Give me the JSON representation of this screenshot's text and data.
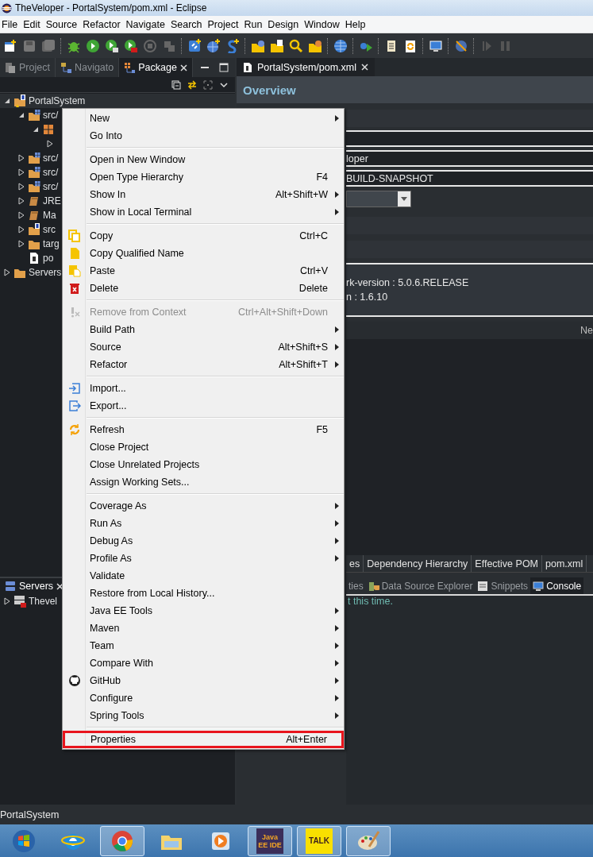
{
  "window": {
    "title": "TheVeloper - PortalSystem/pom.xml - Eclipse"
  },
  "menu_bar": [
    "File",
    "Edit",
    "Source",
    "Refactor",
    "Navigate",
    "Search",
    "Project",
    "Run",
    "Design",
    "Window",
    "Help"
  ],
  "view_tabs": [
    {
      "label": "Project",
      "selected": false
    },
    {
      "label": "Navigato",
      "selected": false
    },
    {
      "label": "Package",
      "selected": true
    }
  ],
  "project_tree": [
    {
      "label": "PortalSystem",
      "kind": "project",
      "expanded": true,
      "children": [
        {
          "label": "src/",
          "kind": "source-folder",
          "expanded": true,
          "children": [
            {
              "kind": "package",
              "expanded": true,
              "children": [
                {
                  "expanded": false
                }
              ]
            }
          ]
        },
        {
          "label": "src/",
          "kind": "source-folder",
          "expanded": false
        },
        {
          "label": "src/",
          "kind": "source-folder",
          "expanded": false
        },
        {
          "label": "src/",
          "kind": "source-folder",
          "expanded": false
        },
        {
          "label": "JRE",
          "kind": "library",
          "expanded": false
        },
        {
          "label": "Ma",
          "kind": "library",
          "expanded": false
        },
        {
          "label": "src",
          "kind": "spring-folder",
          "expanded": false
        },
        {
          "label": "targ",
          "kind": "folder",
          "expanded": false
        },
        {
          "label": "po",
          "kind": "file"
        }
      ]
    },
    {
      "label": "Servers",
      "kind": "folder",
      "expanded": false
    }
  ],
  "servers_view": {
    "tab": {
      "label": "Servers",
      "selected": true
    },
    "rows": [
      {
        "label": "Thevel",
        "expanded": false
      }
    ]
  },
  "editor": {
    "tab": {
      "label": "PortalSystem/pom.xml",
      "selected": true
    },
    "heading": "Overview",
    "fields": [
      "loper",
      "BUILD-SNAPSHOT"
    ],
    "properties": [
      "rk-version : 5.0.6.RELEASE",
      "n : 1.6.10"
    ],
    "side_label": "Ne",
    "pom_tabs": [
      {
        "label": "es",
        "selected": false
      },
      {
        "label": "Dependency Hierarchy",
        "selected": false
      },
      {
        "label": "Effective POM",
        "selected": false
      },
      {
        "label": "pom.xml",
        "selected": false
      }
    ]
  },
  "console": {
    "tabs": [
      {
        "label": "ties",
        "selected": false
      },
      {
        "label": "Data Source Explorer",
        "selected": false
      },
      {
        "label": "Snippets",
        "selected": false
      },
      {
        "label": "Console",
        "selected": true
      }
    ],
    "message": "t this time."
  },
  "context_menu": [
    {
      "kind": "item",
      "label": "New",
      "submenu": true,
      "disabled": false,
      "outlined": false
    },
    {
      "kind": "item",
      "label": "Go Into",
      "submenu": false,
      "disabled": false,
      "outlined": false
    },
    {
      "kind": "separator"
    },
    {
      "kind": "item",
      "label": "Open in New Window",
      "submenu": false,
      "disabled": false,
      "outlined": false
    },
    {
      "kind": "item",
      "label": "Open Type Hierarchy",
      "shortcut": "F4",
      "submenu": false,
      "disabled": false,
      "outlined": false
    },
    {
      "kind": "item",
      "label": "Show In",
      "shortcut": "Alt+Shift+W",
      "submenu": true,
      "disabled": false,
      "outlined": false
    },
    {
      "kind": "item",
      "label": "Show in Local Terminal",
      "submenu": true,
      "disabled": false,
      "outlined": false
    },
    {
      "kind": "separator"
    },
    {
      "kind": "item",
      "label": "Copy",
      "shortcut": "Ctrl+C",
      "submenu": false,
      "disabled": false,
      "outlined": false
    },
    {
      "kind": "item",
      "label": "Copy Qualified Name",
      "submenu": false,
      "disabled": false,
      "outlined": false
    },
    {
      "kind": "item",
      "label": "Paste",
      "shortcut": "Ctrl+V",
      "submenu": false,
      "disabled": false,
      "outlined": false
    },
    {
      "kind": "item",
      "label": "Delete",
      "shortcut": "Delete",
      "submenu": false,
      "disabled": false,
      "outlined": false
    },
    {
      "kind": "separator"
    },
    {
      "kind": "item",
      "label": "Remove from Context",
      "shortcut": "Ctrl+Alt+Shift+Down",
      "submenu": false,
      "disabled": true,
      "outlined": false
    },
    {
      "kind": "item",
      "label": "Build Path",
      "submenu": true,
      "disabled": false,
      "outlined": false
    },
    {
      "kind": "item",
      "label": "Source",
      "shortcut": "Alt+Shift+S",
      "submenu": true,
      "disabled": false,
      "outlined": false
    },
    {
      "kind": "item",
      "label": "Refactor",
      "shortcut": "Alt+Shift+T",
      "submenu": true,
      "disabled": false,
      "outlined": false
    },
    {
      "kind": "separator"
    },
    {
      "kind": "item",
      "label": "Import...",
      "submenu": false,
      "disabled": false,
      "outlined": false
    },
    {
      "kind": "item",
      "label": "Export...",
      "submenu": false,
      "disabled": false,
      "outlined": false
    },
    {
      "kind": "separator"
    },
    {
      "kind": "item",
      "label": "Refresh",
      "shortcut": "F5",
      "submenu": false,
      "disabled": false,
      "outlined": false
    },
    {
      "kind": "item",
      "label": "Close Project",
      "submenu": false,
      "disabled": false,
      "outlined": false
    },
    {
      "kind": "item",
      "label": "Close Unrelated Projects",
      "submenu": false,
      "disabled": false,
      "outlined": false
    },
    {
      "kind": "item",
      "label": "Assign Working Sets...",
      "submenu": false,
      "disabled": false,
      "outlined": false
    },
    {
      "kind": "separator"
    },
    {
      "kind": "item",
      "label": "Coverage As",
      "submenu": true,
      "disabled": false,
      "outlined": false
    },
    {
      "kind": "item",
      "label": "Run As",
      "submenu": true,
      "disabled": false,
      "outlined": false
    },
    {
      "kind": "item",
      "label": "Debug As",
      "submenu": true,
      "disabled": false,
      "outlined": false
    },
    {
      "kind": "item",
      "label": "Profile As",
      "submenu": true,
      "disabled": false,
      "outlined": false
    },
    {
      "kind": "item",
      "label": "Validate",
      "submenu": false,
      "disabled": false,
      "outlined": false
    },
    {
      "kind": "item",
      "label": "Restore from Local History...",
      "submenu": false,
      "disabled": false,
      "outlined": false
    },
    {
      "kind": "item",
      "label": "Java EE Tools",
      "submenu": true,
      "disabled": false,
      "outlined": false
    },
    {
      "kind": "item",
      "label": "Maven",
      "submenu": true,
      "disabled": false,
      "outlined": false
    },
    {
      "kind": "item",
      "label": "Team",
      "submenu": true,
      "disabled": false,
      "outlined": false
    },
    {
      "kind": "item",
      "label": "Compare With",
      "submenu": true,
      "disabled": false,
      "outlined": false
    },
    {
      "kind": "item",
      "label": "GitHub",
      "submenu": true,
      "disabled": false,
      "outlined": false
    },
    {
      "kind": "item",
      "label": "Configure",
      "submenu": true,
      "disabled": false,
      "outlined": false
    },
    {
      "kind": "item",
      "label": "Spring Tools",
      "submenu": true,
      "disabled": false,
      "outlined": false
    },
    {
      "kind": "separator"
    },
    {
      "kind": "item",
      "label": "Properties",
      "shortcut": "Alt+Enter",
      "submenu": false,
      "disabled": false,
      "outlined": true
    }
  ],
  "status_bar": "PortalSystem",
  "taskbar": [
    {
      "kind": "start",
      "running": false
    },
    {
      "kind": "ie",
      "running": false
    },
    {
      "kind": "chrome",
      "running": true
    },
    {
      "kind": "explorer",
      "running": false
    },
    {
      "kind": "media",
      "running": false
    },
    {
      "kind": "javaee",
      "label": "Java EE IDE",
      "running": true
    },
    {
      "kind": "talk",
      "label": "TALK",
      "running": true
    },
    {
      "kind": "paint",
      "running": true
    }
  ]
}
